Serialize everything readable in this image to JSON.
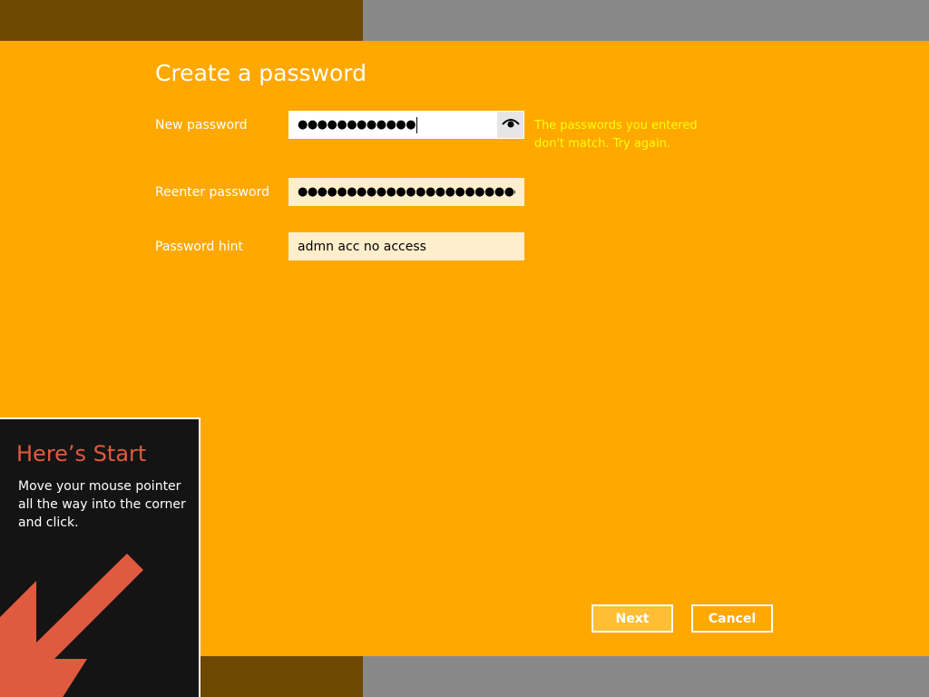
{
  "colors": {
    "background": "#ffa800",
    "band_dark": "#6e4800",
    "band_gray": "#888888",
    "error_text": "#ffff00",
    "tip_background": "#141414",
    "tip_accent": "#e05a40"
  },
  "form": {
    "title": "Create a password",
    "new_password": {
      "label": "New password",
      "masked_value": "●●●●●●●●●●●●",
      "reveal_icon": "eye-icon"
    },
    "reenter_password": {
      "label": "Reenter password",
      "masked_value": "●●●●●●●●●●●●●●●●●●●●●●●●"
    },
    "password_hint": {
      "label": "Password hint",
      "value": "admn acc no access"
    },
    "error_message": "The passwords you entered don't match. Try again."
  },
  "buttons": {
    "next": "Next",
    "cancel": "Cancel"
  },
  "start_tip": {
    "title": "Here’s Start",
    "body": "Move your mouse pointer all the way into the corner and click.",
    "arrow_icon": "arrow-down-left-icon"
  }
}
